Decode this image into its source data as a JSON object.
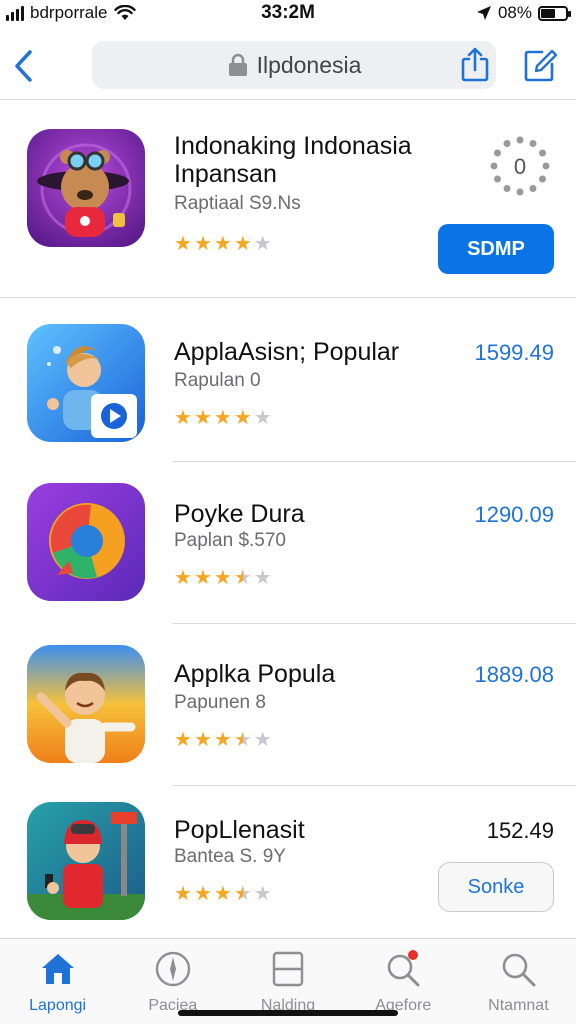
{
  "status_bar": {
    "carrier": "bdrporrale",
    "time": "33:2M",
    "battery_pct": "08%",
    "battery_level": 0.6
  },
  "nav": {
    "search_text": "Ilpdonesia",
    "back_icon": "chevron-left-icon",
    "share_icon": "share-icon",
    "compose_icon": "compose-icon"
  },
  "featured": {
    "title_line1": "Indonaking Indonasia",
    "title_line2": "Inpansan",
    "subtitle": "Raptiaal S9.Ns",
    "rating": 4,
    "button_label": "SDMP",
    "loader_label": "0"
  },
  "apps": [
    {
      "title": "ApplaAsisn; Popular",
      "subtitle": "Rapulan 0",
      "rating": 4,
      "price": "1599.49",
      "price_color": "#1f73d6"
    },
    {
      "title": "Poyke Dura",
      "subtitle": "Paplan $.570",
      "rating": 3.5,
      "price": "1290.09",
      "price_color": "#1f73d6"
    },
    {
      "title": "Applka Popula",
      "subtitle": "Papunen 8",
      "rating": 3.5,
      "price": "1889.08",
      "price_color": "#1f73d6"
    },
    {
      "title": "PopLlenasit",
      "subtitle": "Bantea S. 9Y",
      "rating": 3.5,
      "price": "152.49",
      "price_color": "#111111",
      "button_label": "Sonke"
    }
  ],
  "tabs": [
    {
      "label": "Lapongi",
      "icon": "home-icon",
      "active": true
    },
    {
      "label": "Paciea",
      "icon": "compass-icon",
      "active": false
    },
    {
      "label": "Nalding",
      "icon": "square-icon",
      "active": false
    },
    {
      "label": "Agefore",
      "icon": "search-badge-icon",
      "active": false
    },
    {
      "label": "Ntamnat",
      "icon": "search-icon",
      "active": false
    }
  ],
  "colors": {
    "accent": "#1f73d6",
    "star": "#f5a623"
  }
}
